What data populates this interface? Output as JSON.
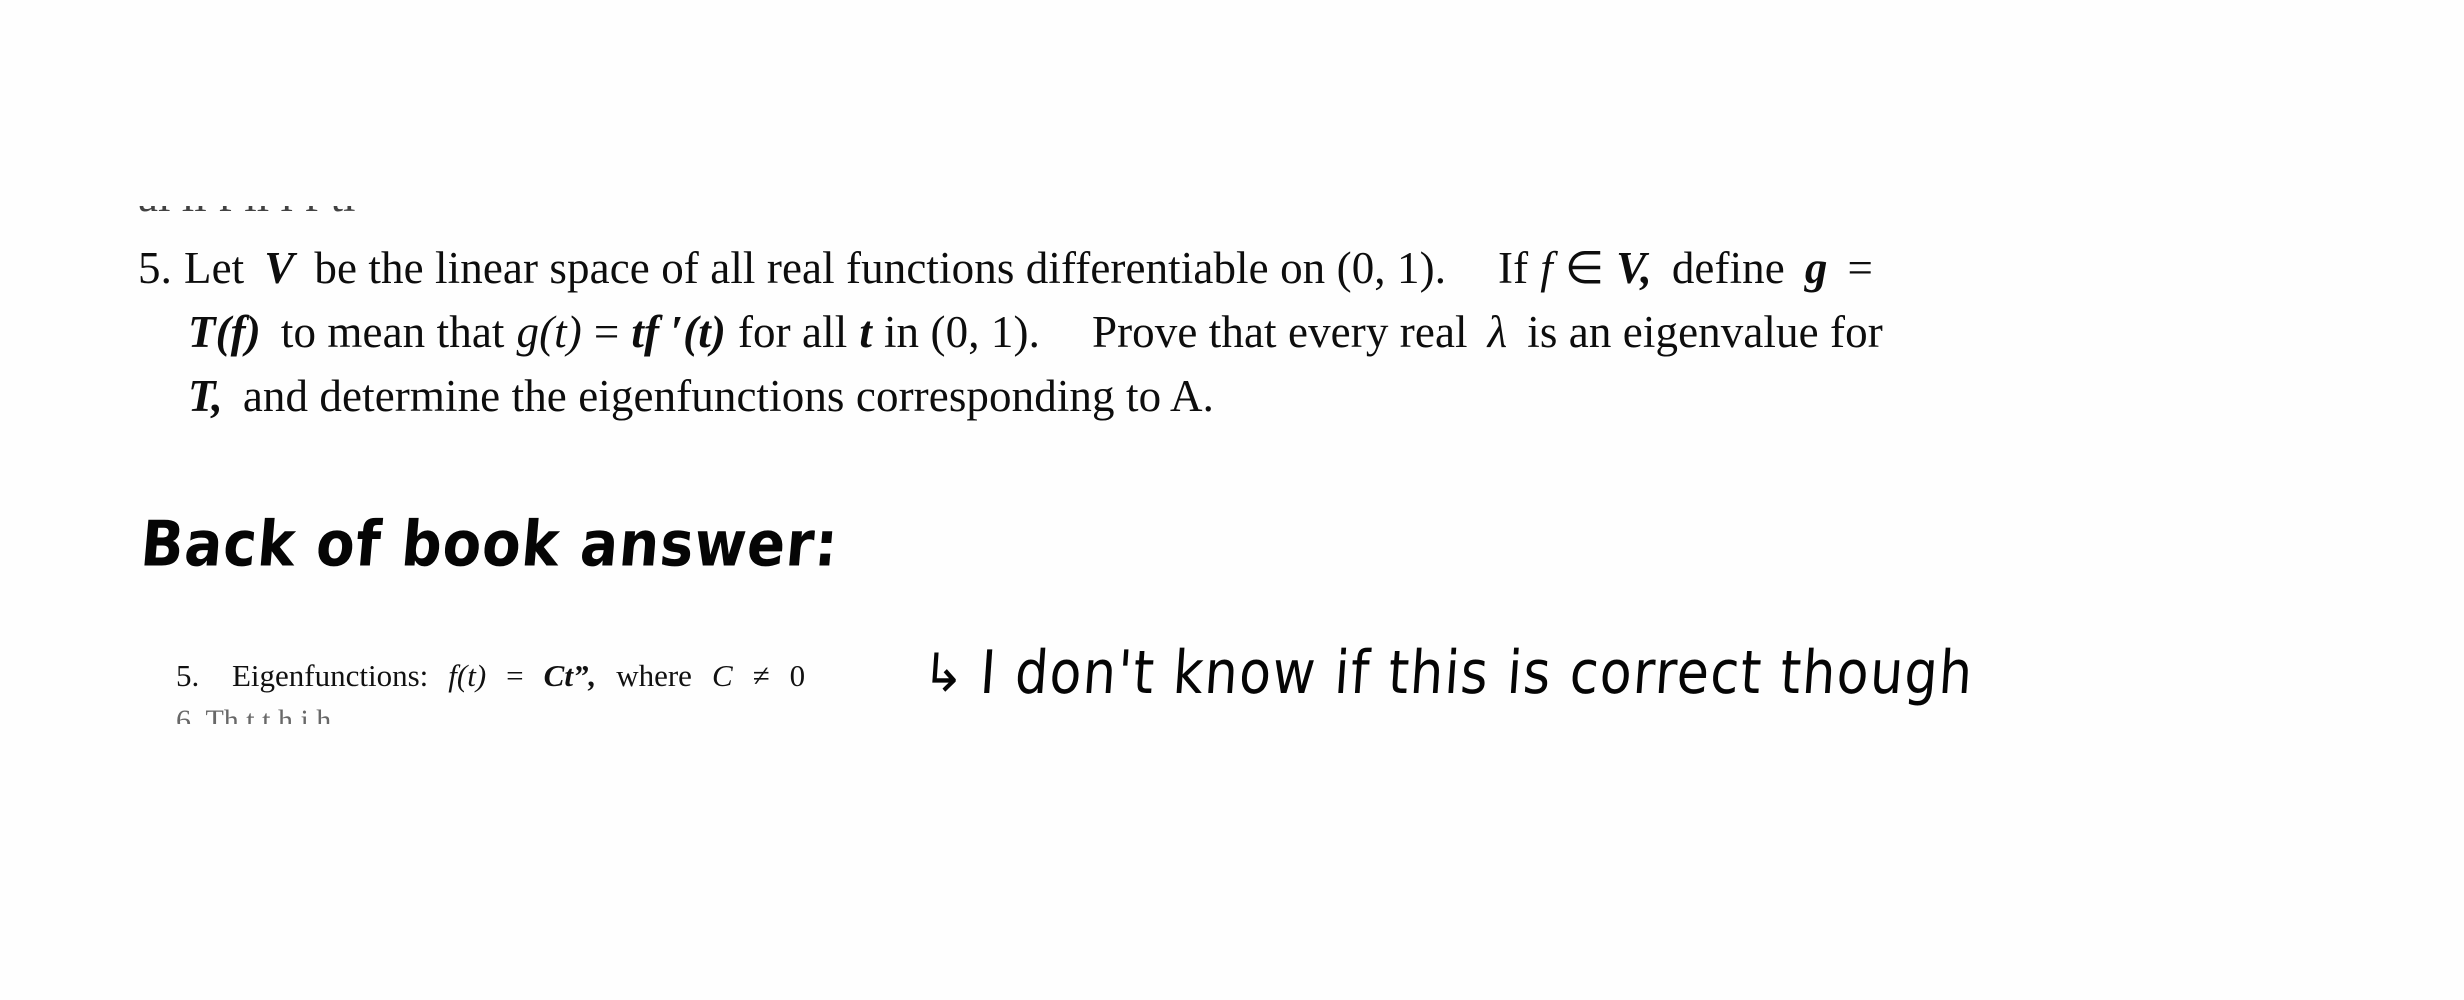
{
  "document": {
    "type": "scanned-textbook-problem-with-handwritten-annotation",
    "background_color": "#ffffff",
    "ink_color": "#0d0d0d"
  },
  "problem": {
    "number": "5.",
    "line1_parts": {
      "a": "Let",
      "var_V": "V",
      "b": "be  the  linear  space  of  all  real  functions  differentiable  on  (0, 1).",
      "c": "If",
      "var_f": "f",
      "member": "∈",
      "var_V2": "V,",
      "d": "define",
      "var_g": "g",
      "eq": "="
    },
    "line2_parts": {
      "Tf": "T(f)",
      "a": "to mean that",
      "gt": "g(t)",
      "eq": "=",
      "tfprime": "tf ′(t)",
      "b": "for all",
      "var_t": "t",
      "c": "in (0, 1).",
      "d": "Prove  that  every  real",
      "lambda": "λ",
      "e": "is  an  eigenvalue  for"
    },
    "line3_parts": {
      "var_T": "T,",
      "a": "and  determine  the  eigenfunctions  corresponding  to  A."
    },
    "full_text": "5. Let V be the linear space of all real functions differentiable on (0, 1). If f ∈ V, define g = T(f) to mean that g(t) = tf ′(t) for all t in (0, 1). Prove that every real λ is an eigenvalue for T, and determine the eigenfunctions corresponding to A."
  },
  "ghost_line_above": "al  ll        f ll     l f    ti",
  "handwritten_heading": {
    "text": "Back of book answer:"
  },
  "answer": {
    "number": "5.",
    "label": "Eigenfunctions:",
    "fn": "f(t)",
    "eq": "=",
    "expr": "Ct”,",
    "where": "where",
    "var_C": "C",
    "neq": "≠",
    "zero": "0",
    "full_text": "5.   Eigenfunctions:  f(t)  =  Ct”,  where  C  ≠  0"
  },
  "ghost_line_below": "6.    Th                    t         t        h           i   h",
  "handwritten_note": {
    "arrow": "↳",
    "text": "I don't know if this is correct though",
    "full_text": "↳ I don't know if this is correct though"
  }
}
